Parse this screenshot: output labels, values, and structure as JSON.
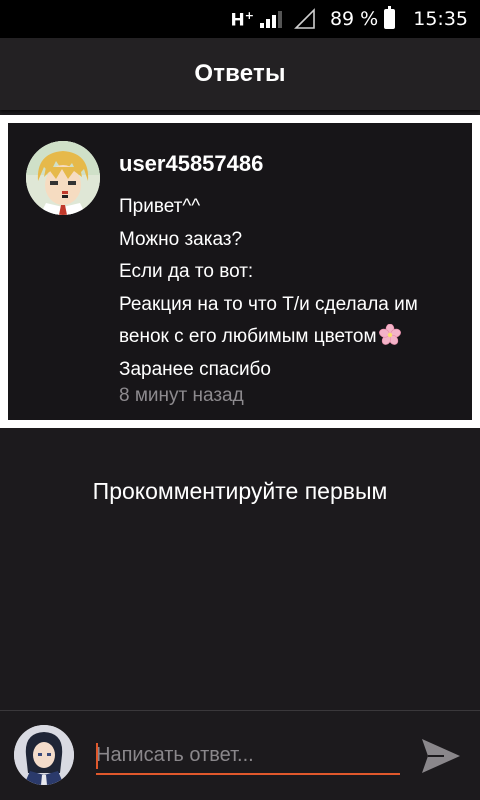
{
  "status_bar": {
    "network": "H",
    "network_sup": "+",
    "battery_percent": "89 %",
    "time": "15:35"
  },
  "header": {
    "title": "Ответы"
  },
  "question": {
    "username": "user45857486",
    "lines": [
      "Привет^^",
      "Можно заказ?",
      "Если да то вот:",
      "Реакция на то что Т/и сделала им",
      "венок с его любимым цветом",
      "Заранее спасибо"
    ],
    "emoji": "cherry-blossom-icon",
    "timestamp": "8 минут назад"
  },
  "comments": {
    "empty_text": "Прокомментируйте первым"
  },
  "reply": {
    "placeholder": "Написать ответ...",
    "value": ""
  },
  "colors": {
    "accent": "#e0582c",
    "background": "#1c1a1d",
    "card": "#171518",
    "muted_text": "#8d8a8e"
  }
}
